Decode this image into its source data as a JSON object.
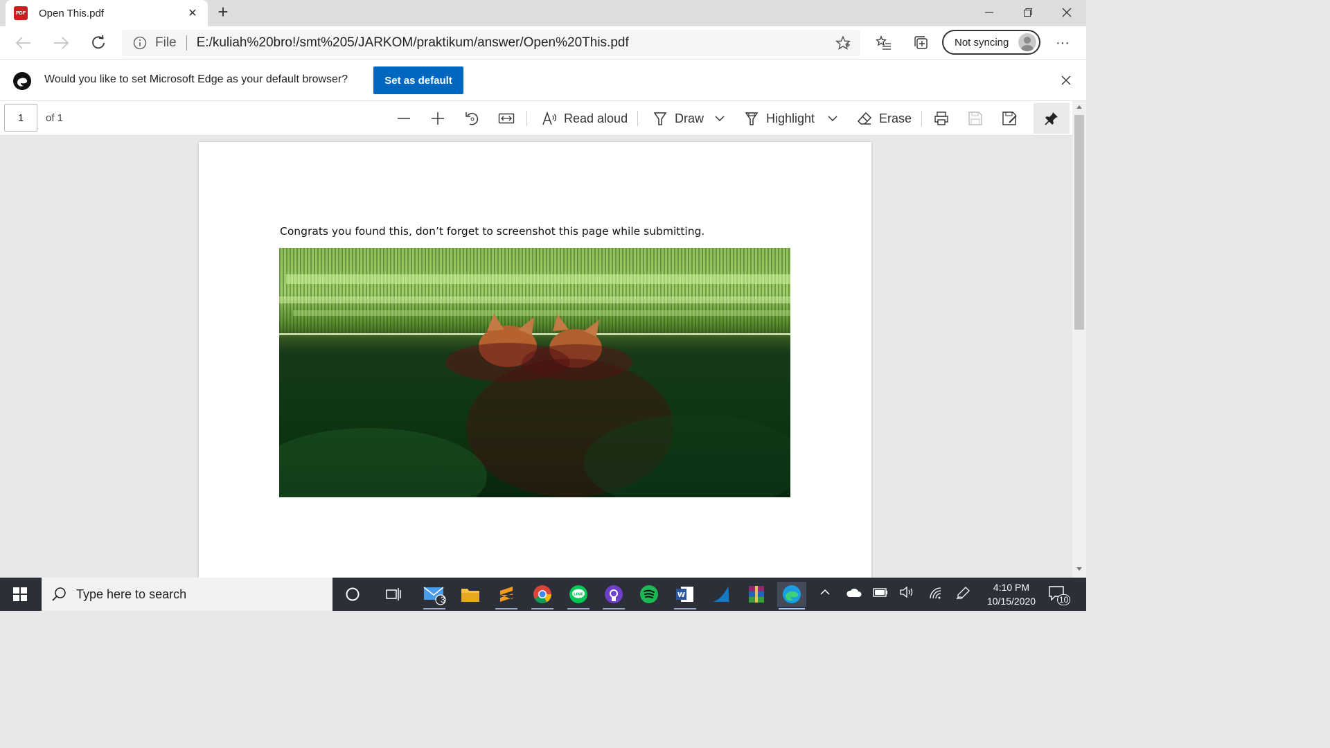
{
  "tab": {
    "title": "Open This.pdf",
    "icon": "pdf-icon"
  },
  "address": {
    "scheme_label": "File",
    "url": "E:/kuliah%20bro!/smt%205/JARKOM/praktikum/answer/Open%20This.pdf"
  },
  "profile": {
    "sync_label": "Not syncing"
  },
  "banner": {
    "message": "Would you like to set Microsoft Edge as your default browser?",
    "button_label": "Set as default"
  },
  "pdf_toolbar": {
    "page_number": "1",
    "page_count_label": "of 1",
    "read_aloud_label": "Read aloud",
    "draw_label": "Draw",
    "highlight_label": "Highlight",
    "erase_label": "Erase"
  },
  "document": {
    "text": "Congrats you found this, don’t forget to screenshot this page while submitting."
  },
  "taskbar": {
    "search_placeholder": "Type here to search",
    "mail_badge": "3",
    "time": "4:10 PM",
    "date": "10/15/2020",
    "notification_count": "10"
  },
  "colors": {
    "accent": "#0067c0",
    "taskbar": "#2b2f38",
    "pdf_red": "#c8201f"
  }
}
